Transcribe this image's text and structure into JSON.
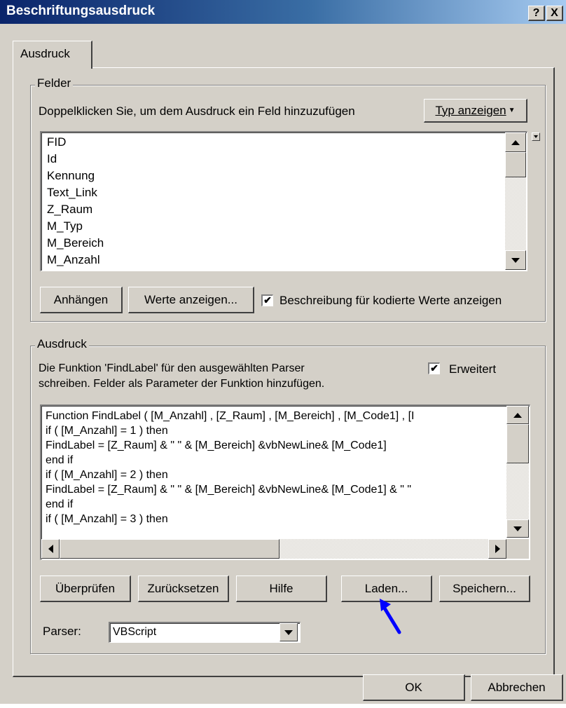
{
  "window": {
    "title": "Beschriftungsausdruck",
    "help_label": "?",
    "close_label": "X"
  },
  "tab": {
    "label": "Ausdruck"
  },
  "fields_group": {
    "legend": "Felder",
    "instruction": "Doppelklicken Sie, um dem Ausdruck ein Feld hinzuzufügen",
    "type_button_label": "Typ anzeigen",
    "items": [
      "FID",
      "Id",
      "Kennung",
      "Text_Link",
      "Z_Raum",
      "M_Typ",
      "M_Bereich",
      "M_Anzahl"
    ],
    "append_button_label": "Anhängen",
    "show_values_button_label": "Werte anzeigen...",
    "coded_values_checkbox": {
      "label": "Beschreibung für kodierte Werte anzeigen",
      "checked": true,
      "mark": "✔"
    }
  },
  "expression_group": {
    "legend": "Ausdruck",
    "instruction_line1": "Die Funktion 'FindLabel' für den ausgewählten Parser",
    "instruction_line2": "schreiben. Felder als Parameter der Funktion hinzufügen.",
    "advanced_checkbox": {
      "label": "Erweitert",
      "checked": true,
      "mark": "✔"
    },
    "code_lines": [
      "Function FindLabel ( [M_Anzahl] , [Z_Raum] ,  [M_Bereich] , [M_Code1] , [I",
      "if ( [M_Anzahl] = 1 ) then",
      "FindLabel = [Z_Raum] & \"  \" & [M_Bereich] &vbNewLine& [M_Code1]",
      "end if",
      "if ( [M_Anzahl] = 2 ) then",
      "FindLabel = [Z_Raum] & \"  \" & [M_Bereich] &vbNewLine& [M_Code1] & \"  \"",
      "end if",
      "if ( [M_Anzahl] = 3 ) then"
    ],
    "buttons": {
      "verify": "Überprüfen",
      "reset": "Zurücksetzen",
      "help": "Hilfe",
      "load": "Laden...",
      "save": "Speichern..."
    },
    "parser_label": "Parser:",
    "parser_value": "VBScript"
  },
  "footer": {
    "ok_label": "OK",
    "cancel_label": "Abbrechen"
  },
  "annotation": {
    "arrow_color": "#0000ff",
    "target": "Laden..."
  },
  "colors": {
    "dialog_bg": "#d4d0c8",
    "titlebar_start": "#0a246a",
    "titlebar_end": "#a6caf0"
  }
}
